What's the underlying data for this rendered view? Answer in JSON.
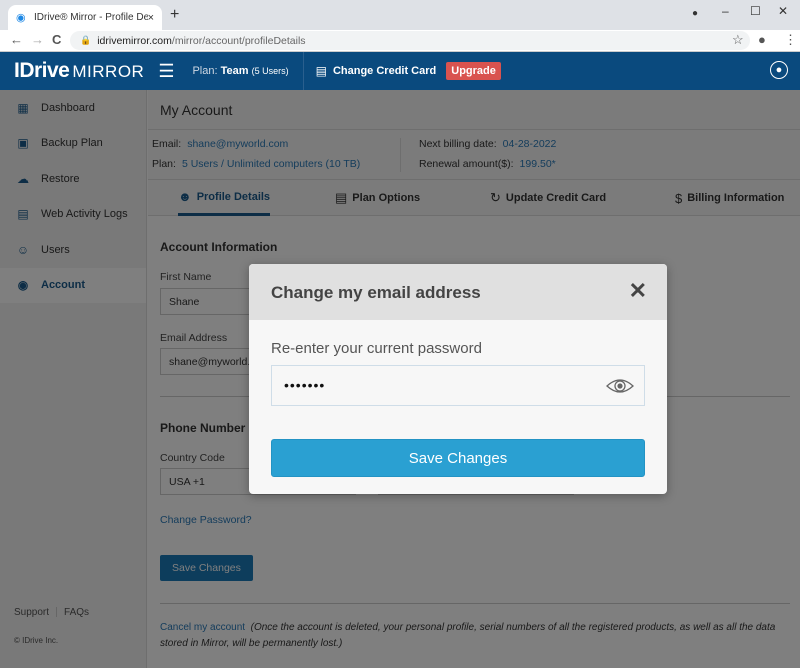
{
  "browser": {
    "tab_title": "IDrive® Mirror - Profile Details",
    "tab_close": "×",
    "new_tab": "+",
    "url_host": "idrivemirror.com",
    "url_path": "/mirror/account/profileDetails",
    "minimize": "–",
    "maximize": "☐",
    "close": "✕",
    "back": "←",
    "forward": "→",
    "reload": "C",
    "star": "☆",
    "menu": "⋮"
  },
  "header": {
    "logo_main": "IDrive",
    "logo_sub": "MIRROR",
    "plan_label": "Plan:",
    "plan_name": "Team",
    "plan_users": "(5 Users)",
    "change_credit_card": "Change Credit Card",
    "upgrade": "Upgrade"
  },
  "sidebar": {
    "items": [
      {
        "label": "Dashboard",
        "icon": "dashboard-icon"
      },
      {
        "label": "Backup Plan",
        "icon": "backup-plan-icon"
      },
      {
        "label": "Restore",
        "icon": "restore-icon"
      },
      {
        "label": "Web Activity Logs",
        "icon": "logs-icon"
      },
      {
        "label": "Users",
        "icon": "users-icon"
      },
      {
        "label": "Account",
        "icon": "account-icon",
        "active": true
      }
    ],
    "support": "Support",
    "faqs": "FAQs",
    "copyright": "© IDrive Inc."
  },
  "main": {
    "title": "My Account",
    "summary": {
      "email_label": "Email:",
      "email_value": "shane@myworld.com",
      "plan_label": "Plan:",
      "plan_value": "5 Users / Unlimited computers (10 TB)",
      "billing_label": "Next billing date:",
      "billing_value": "04-28-2022",
      "renewal_label": "Renewal amount($):",
      "renewal_value": "199.50*"
    },
    "tabs": [
      {
        "label": "Profile Details",
        "active": true
      },
      {
        "label": "Plan Options"
      },
      {
        "label": "Update Credit Card"
      },
      {
        "label": "Billing Information"
      }
    ],
    "account_info_heading": "Account Information",
    "first_name_label": "First Name",
    "first_name_value": "Shane",
    "email_label": "Email Address",
    "email_value": "shane@myworld.com",
    "phone_heading": "Phone Number",
    "country_code_label": "Country Code",
    "country_code_value": "USA +1",
    "change_password": "Change Password?",
    "save_changes": "Save Changes",
    "cancel_account": "Cancel my account",
    "cancel_note": "(Once the account is deleted, your personal profile, serial numbers of all the registered products, as well as all the data stored in Mirror, will be permanently lost.)"
  },
  "modal": {
    "title": "Change my email address",
    "close": "✕",
    "password_label": "Re-enter your current password",
    "password_value": "•••••••",
    "save_button": "Save Changes"
  },
  "colors": {
    "brand": "#0a4a7e",
    "accent": "#2aa0d2",
    "link": "#2a7ab8",
    "upgrade": "#d9534f"
  }
}
